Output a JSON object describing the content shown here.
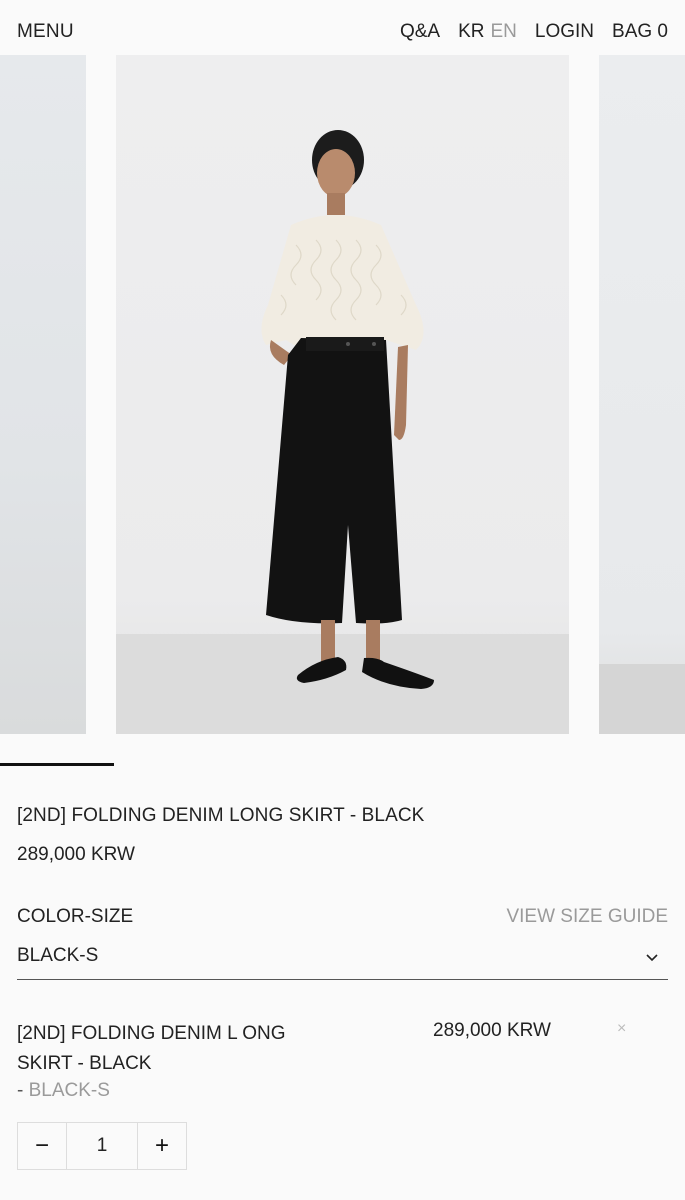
{
  "header": {
    "menu": "MENU",
    "qa": "Q&A",
    "lang_kr": "KR",
    "lang_en": "EN",
    "login": "LOGIN",
    "bag": "BAG 0"
  },
  "product": {
    "title": "[2ND] FOLDING DENIM LONG SKIRT - BLACK",
    "price": "289,000 KRW",
    "option_label": "COLOR-SIZE",
    "size_guide": "VIEW SIZE GUIDE",
    "selected_option": "BLACK-S"
  },
  "selected_item": {
    "name": "[2ND] FOLDING DENIM L ONG SKIRT - BLACK",
    "option_dash": "- ",
    "option": "BLACK-S",
    "price": "289,000 KRW",
    "remove": "×",
    "quantity": "1",
    "minus": "−",
    "plus": "+"
  },
  "icons": {
    "chevron": "chevron-down-icon",
    "close": "close-icon"
  },
  "carousel": {
    "active_slide": 1
  }
}
